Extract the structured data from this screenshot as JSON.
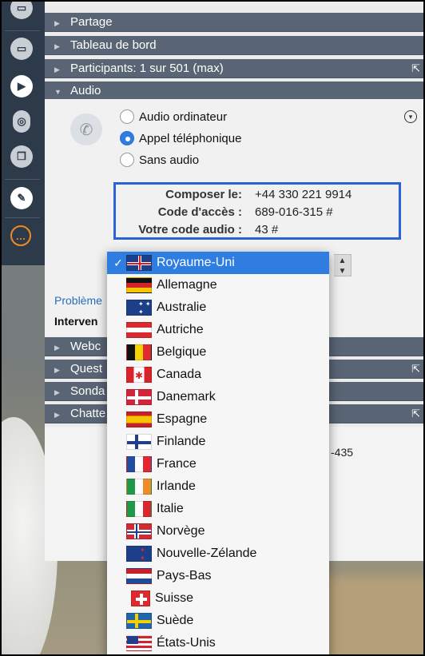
{
  "toolbar": {
    "buttons": [
      "video-icon",
      "screen-share-icon",
      "play-icon",
      "mouse-icon",
      "copy-icon",
      "pencil-icon",
      "chat-icon"
    ]
  },
  "sections": {
    "partage": "Partage",
    "tableau": "Tableau de bord",
    "participants": "Participants: 1 sur 501 (max)",
    "audio": "Audio",
    "webcam": "Webc",
    "questions": "Quest",
    "sondage": "Sonda",
    "chatter": "Chatte"
  },
  "audio": {
    "options": [
      "Audio ordinateur",
      "Appel téléphonique",
      "Sans audio"
    ],
    "selected_index": 1,
    "info": [
      {
        "label": "Composer le:",
        "value": "+44 330 221 9914"
      },
      {
        "label": "Code d'accès :",
        "value": "689-016-315 #"
      },
      {
        "label": "Votre code audio :",
        "value": "43 #"
      }
    ],
    "problem_link": "Problème",
    "intervenants": "Interven",
    "number_tail": "-435"
  },
  "country_dropdown": {
    "check": "✓",
    "items": [
      "Royaume-Uni",
      "Allemagne",
      "Australie",
      "Autriche",
      "Belgique",
      "Canada",
      "Danemark",
      "Espagne",
      "Finlande",
      "France",
      "Irlande",
      "Italie",
      "Norvège",
      "Nouvelle-Zélande",
      "Pays-Bas",
      "Suisse",
      "Suède",
      "États-Unis"
    ],
    "selected": "Royaume-Uni"
  },
  "colors": {
    "accent": "#2f7de1",
    "header": "#596574",
    "highlight_box": "#2a63d6"
  }
}
